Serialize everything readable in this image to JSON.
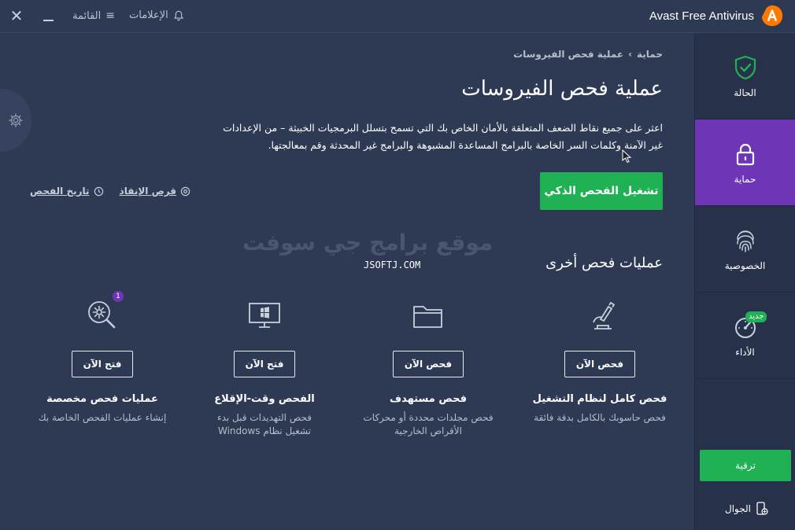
{
  "window": {
    "brand_name": "Avast Free Antivirus",
    "menu_label": "القائمة",
    "notifications_label": "الإعلامات",
    "close_glyph": "✕"
  },
  "sidebar": {
    "items": [
      {
        "label": "الحالة",
        "icon": "shield-check-icon",
        "active": false
      },
      {
        "label": "حماية",
        "icon": "lock-icon",
        "active": true
      },
      {
        "label": "الخصوصية",
        "icon": "fingerprint-icon",
        "active": false
      },
      {
        "label": "الأداء",
        "icon": "speedometer-icon",
        "active": false,
        "badge": "جديد"
      }
    ],
    "upgrade_label": "ترقية",
    "mobile_label": "الجوال"
  },
  "main": {
    "breadcrumb": {
      "root": "حماية",
      "separator": "›",
      "current": "عملية فحص الفيروسات"
    },
    "title": "عملية فحص الفيروسات",
    "description": "اعثر على جميع نقاط الضعف المتعلقة بالأمان الخاص بك التي تسمح بتسلل البرمجيات الخبيثة – من الإعدادات غير الآمنة وكلمات السر الخاصة بالبرامج المساعدة المشبوهة والبرامج غير المحدثة وقم بمعالجتها.",
    "smart_scan_button": "تشغيل الفحص الذكي",
    "rescue_disk_link": "قرص الإنقاذ",
    "scan_history_link": "تاريخ الفحص",
    "other_scans_title": "عمليات فحص أخرى",
    "watermark": "موقع برامج جي سوفت",
    "watermark_sub": "JSOFTJ.COM"
  },
  "scans": [
    {
      "icon": "microscope-icon",
      "button": "فحص الآن",
      "title": "فحص كامل لنظام التشغيل",
      "desc": "فحص حاسوبك بالكامل بدقة فائقة"
    },
    {
      "icon": "folder-icon",
      "button": "فحص الآن",
      "title": "فحص مستهدف",
      "desc": "فحص مجلدات محددة أو محركات الأقراص الخارجية"
    },
    {
      "icon": "monitor-windows-icon",
      "button": "فتح الآن",
      "title": "الفحص وقت-الإقلاع",
      "desc": "فحص التهديدات قبل بدء تشغيل نظام Windows"
    },
    {
      "icon": "gear-search-icon",
      "button": "فتح الآن",
      "title": "عمليات فحص مخصصة",
      "desc": "إنشاء عمليات الفحص الخاصة بك",
      "badge": "1"
    }
  ],
  "colors": {
    "background": "#2e3a54",
    "sidebar": "#27314a",
    "active": "#6e35b6",
    "accent_green": "#1fb154",
    "brand_orange": "#ff7800"
  }
}
